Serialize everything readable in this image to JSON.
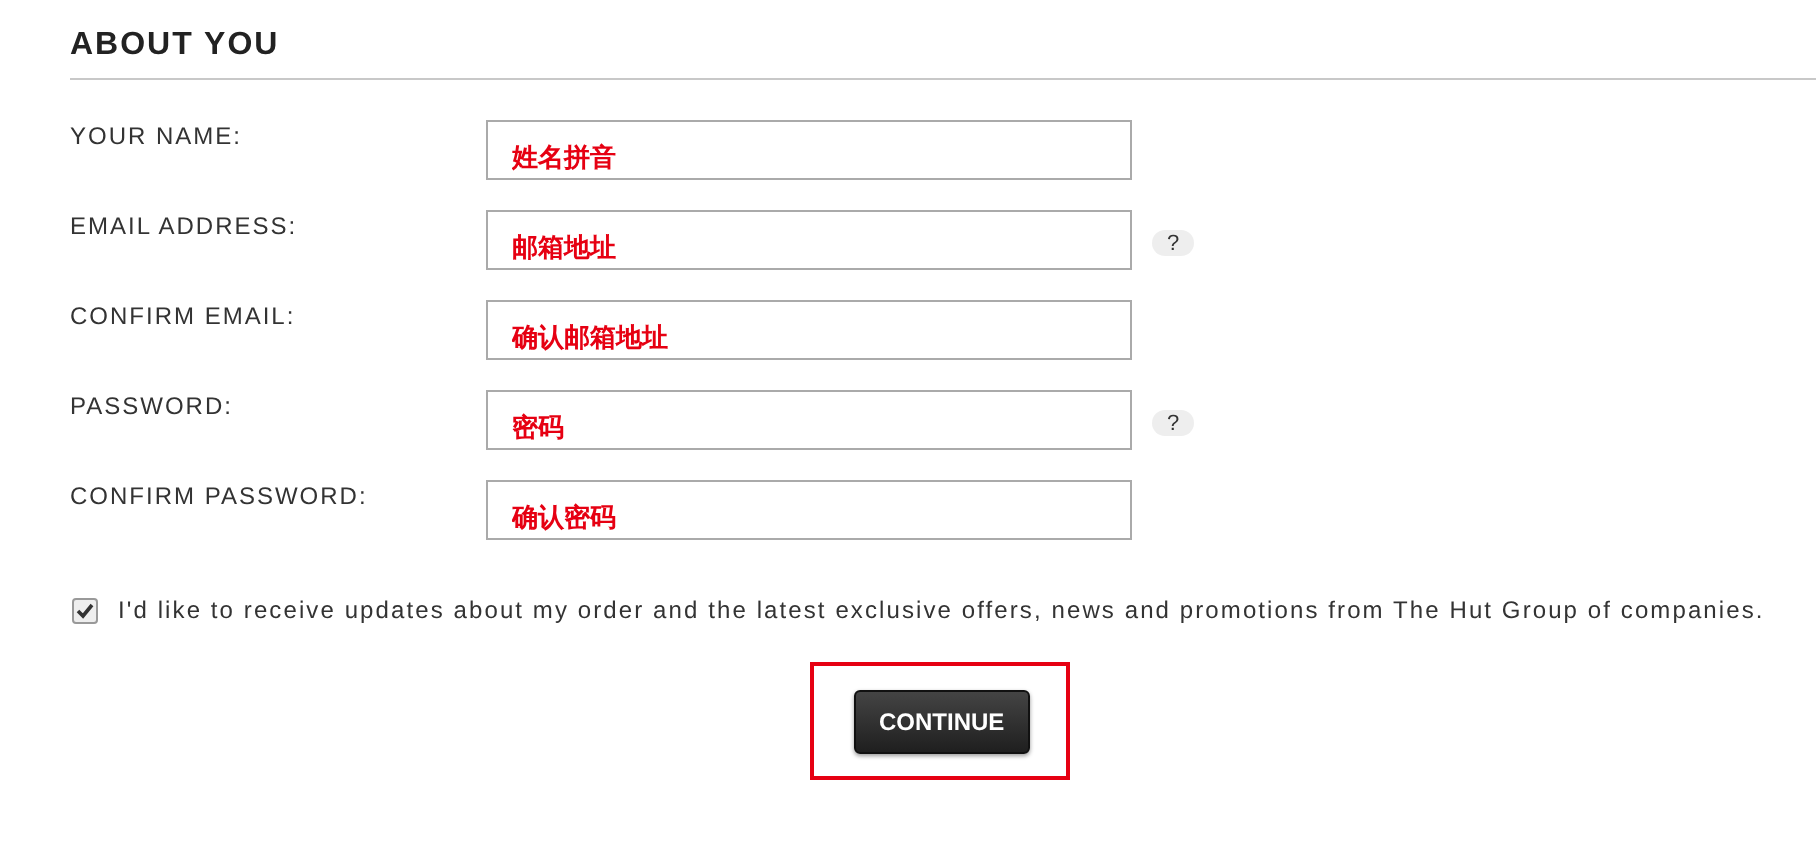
{
  "section": {
    "title": "ABOUT YOU"
  },
  "fields": [
    {
      "label": "YOUR NAME:",
      "value": "姓名拼音"
    },
    {
      "label": "EMAIL ADDRESS:",
      "value": "邮箱地址",
      "help_text": "?"
    },
    {
      "label": "CONFIRM EMAIL:",
      "value": "确认邮箱地址"
    },
    {
      "label": "PASSWORD:",
      "value": "密码",
      "help_text": "?"
    },
    {
      "label": "CONFIRM PASSWORD:",
      "value": "确认密码"
    }
  ],
  "consent": {
    "checked": true,
    "text": "I'd like to receive updates about my order and the latest exclusive offers, news and promotions from The Hut Group of companies."
  },
  "continue_button": {
    "label": "CONTINUE",
    "highlighted": true
  }
}
